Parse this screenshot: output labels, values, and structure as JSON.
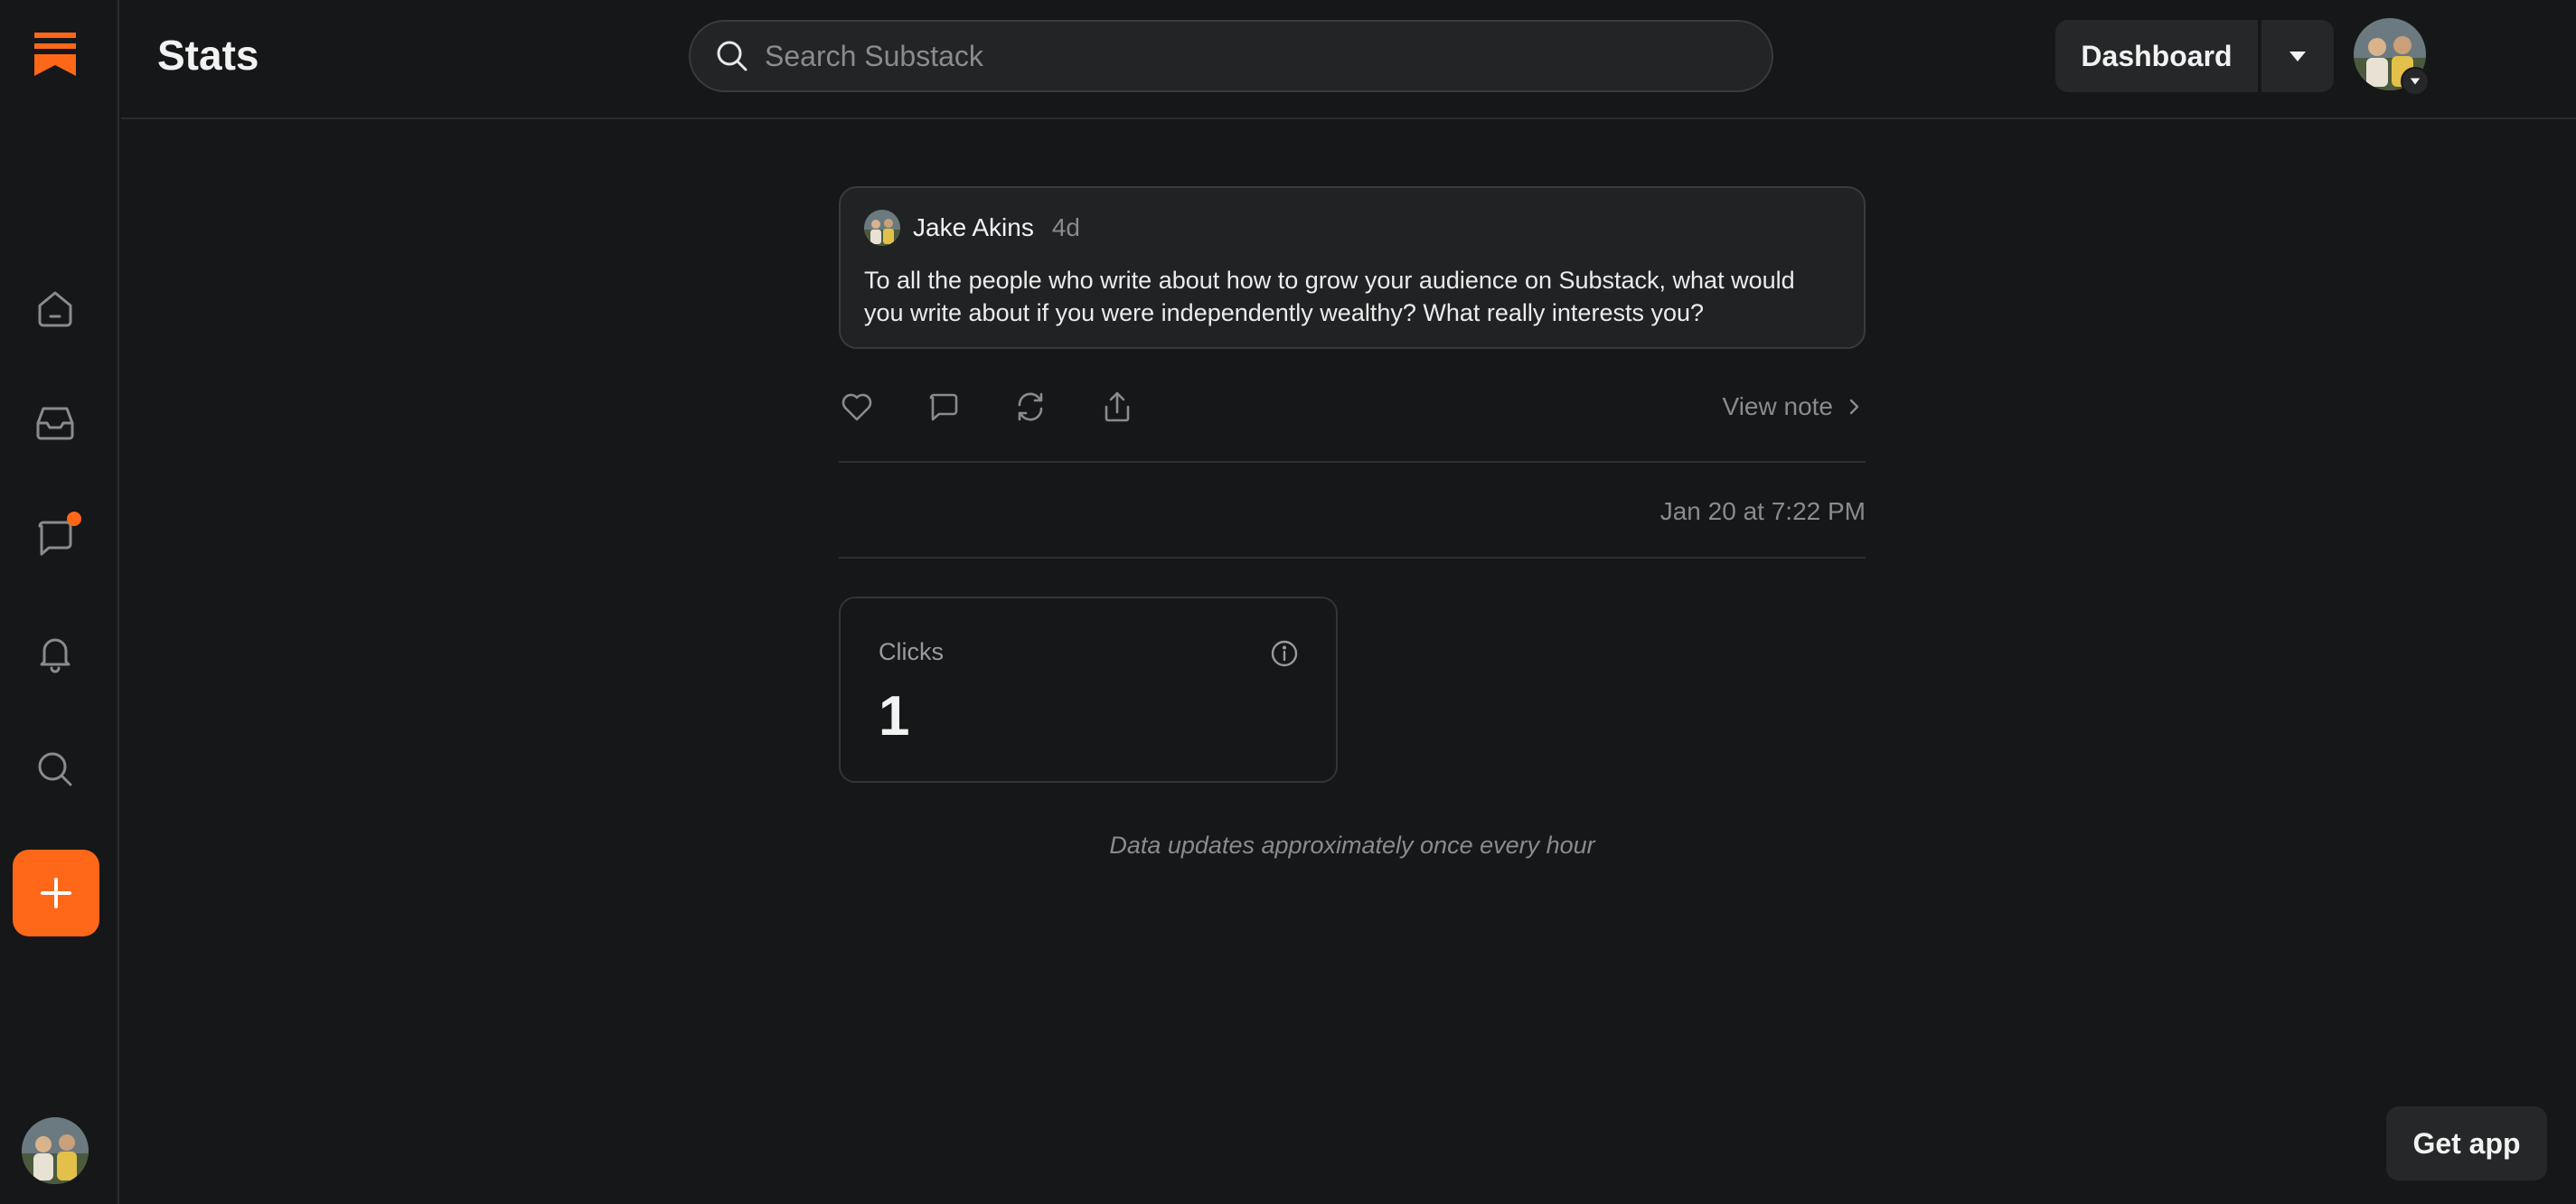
{
  "app": {
    "accent_color": "#ff6719",
    "logo_icon": "substack-logo-icon"
  },
  "sidebar": {
    "items": [
      {
        "name": "home",
        "icon": "home-icon"
      },
      {
        "name": "inbox",
        "icon": "inbox-icon"
      },
      {
        "name": "chat",
        "icon": "chat-icon",
        "has_badge": true
      },
      {
        "name": "activity",
        "icon": "bell-icon"
      },
      {
        "name": "explore",
        "icon": "search-icon"
      }
    ],
    "create_icon": "plus-icon"
  },
  "header": {
    "title": "Stats",
    "search_placeholder": "Search Substack",
    "dashboard_label": "Dashboard"
  },
  "note": {
    "author": "Jake Akins",
    "age": "4d",
    "body": "To all the people who write about how to grow your audience on Substack, what would you write about if you were independently wealthy? What really interests you?",
    "view_note_label": "View note",
    "timestamp": "Jan 20 at 7:22 PM"
  },
  "stats": {
    "clicks_label": "Clicks",
    "clicks_value": "1",
    "update_note": "Data updates approximately once every hour"
  },
  "footer": {
    "get_app_label": "Get app"
  }
}
